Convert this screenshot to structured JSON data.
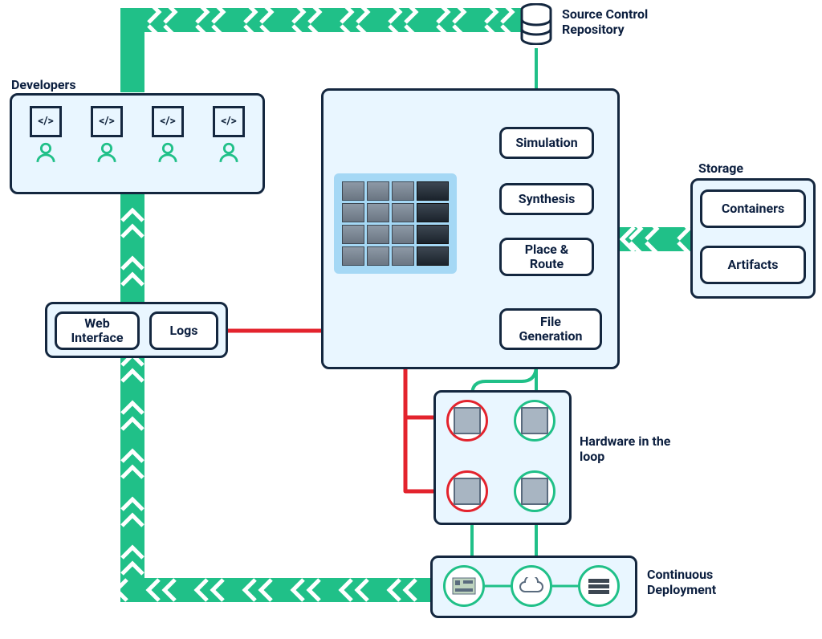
{
  "labels": {
    "developers": "Developers",
    "source_control": "Source Control Repository",
    "storage": "Storage",
    "hardware_loop": "Hardware in the loop",
    "continuous_deployment": "Continuous Deployment"
  },
  "pipeline": {
    "simulation": "Simulation",
    "synthesis": "Synthesis",
    "place_route": "Place & Route",
    "file_generation": "File Generation"
  },
  "feedback": {
    "web_interface": "Web Interface",
    "logs": "Logs"
  },
  "storage": {
    "containers": "Containers",
    "artifacts": "Artifacts"
  },
  "dev_icon_text": "</>",
  "colors": {
    "navy": "#14273f",
    "green": "#20c088",
    "red": "#e3232d",
    "panel": "#e9f6ff"
  }
}
